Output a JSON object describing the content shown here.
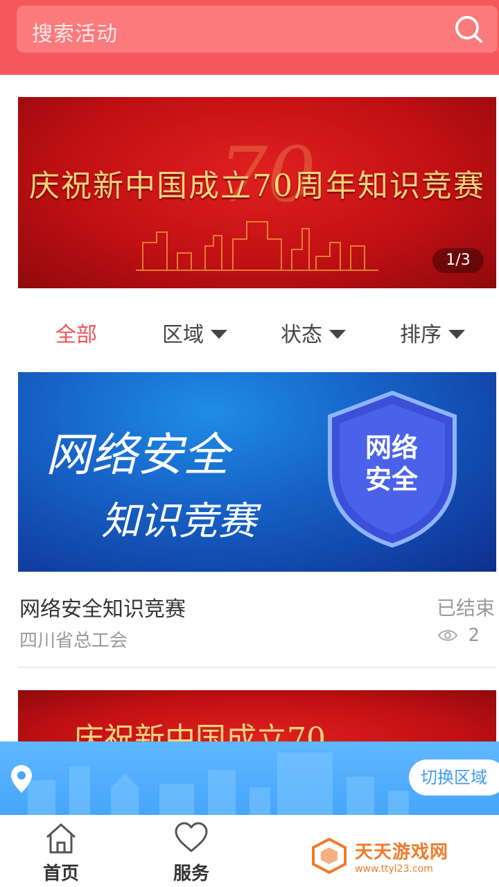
{
  "search": {
    "placeholder": "搜索活动",
    "icon": "search-icon"
  },
  "top_banner": {
    "title": "庆祝新中国成立70周年知识竞赛",
    "counter": "1/3"
  },
  "filters": [
    {
      "label": "全部",
      "active": true
    },
    {
      "label": "区域",
      "active": false
    },
    {
      "label": "状态",
      "active": false
    },
    {
      "label": "排序",
      "active": false
    }
  ],
  "card": {
    "image_line1": "网络安全",
    "image_line2": "知识竞赛",
    "shield_text": "网络 安全",
    "title": "网络安全知识竞赛",
    "status": "已结束",
    "organizer": "四川省总工会",
    "views": "2"
  },
  "second_banner": {
    "title": "庆祝新中国成立70"
  },
  "region_bar": {
    "switch_label": "切换区域"
  },
  "bottom_nav": [
    {
      "label": "首页",
      "icon": "home-icon"
    },
    {
      "label": "服务",
      "icon": "heart-icon"
    }
  ],
  "watermark": {
    "title": "天天游戏网",
    "url": "www.ttyl23.com"
  },
  "colors": {
    "header": "#f4585b",
    "accent": "#f05256",
    "region_bar": "#46a6fb"
  }
}
